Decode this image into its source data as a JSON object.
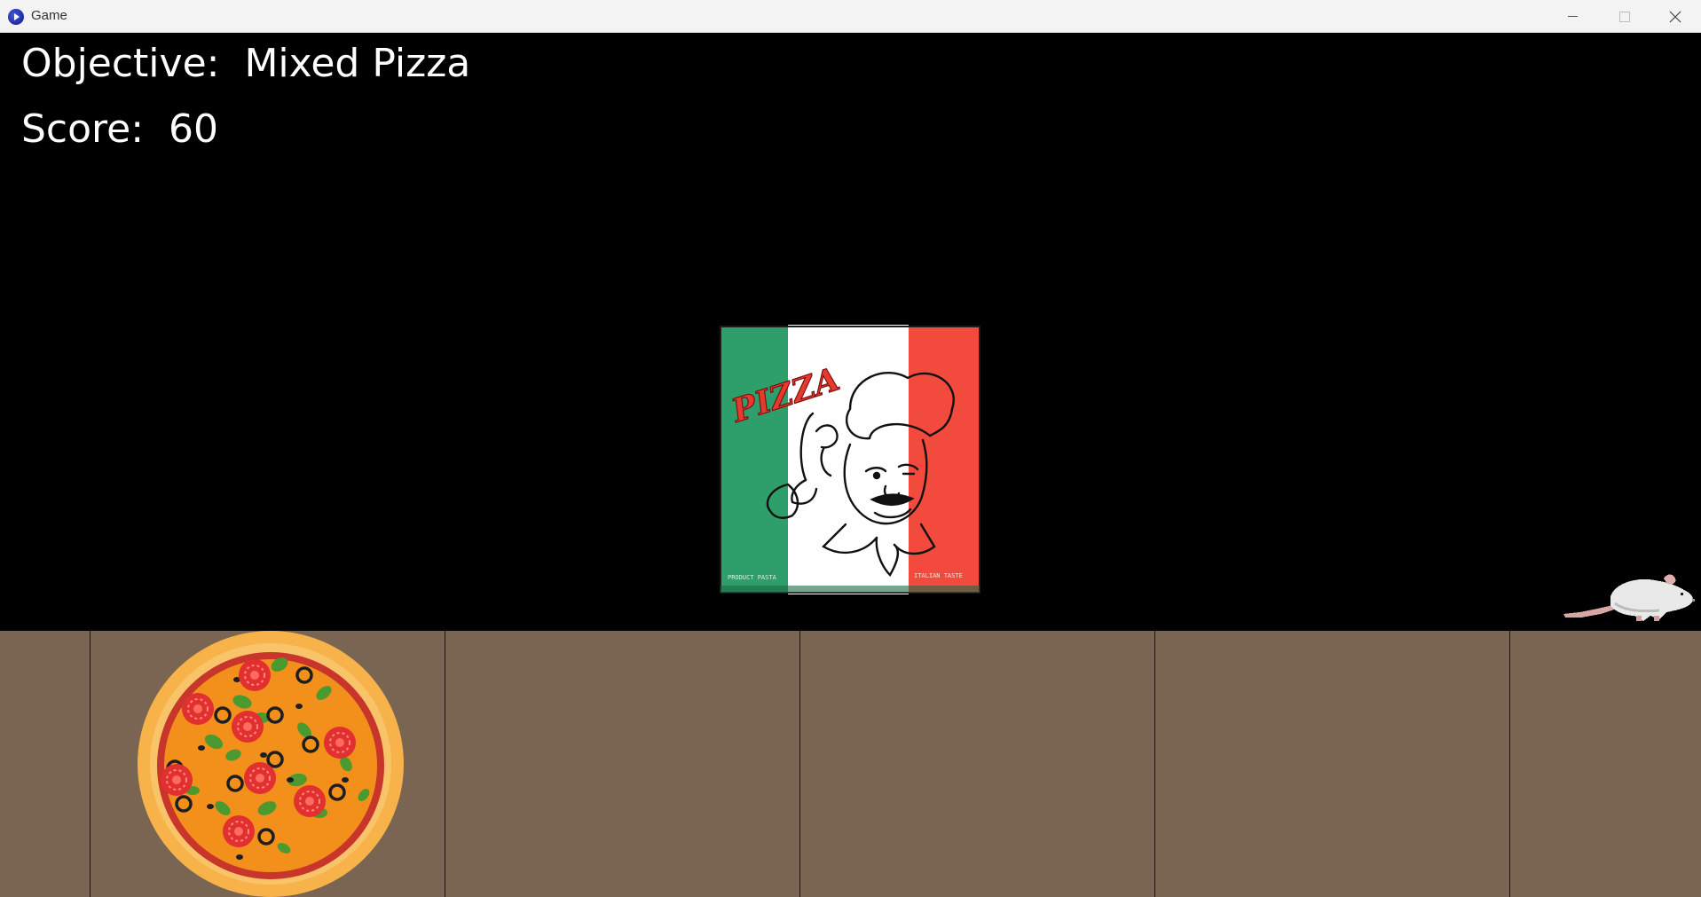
{
  "window": {
    "title": "Game"
  },
  "hud": {
    "objective_label": "Objective:",
    "objective_value": "Mixed Pizza",
    "score_label": "Score:",
    "score_value": "60"
  },
  "pizza_box": {
    "brand_text": "PIZZA",
    "left_small_text": "PRODUCT PASTA",
    "right_small_text": "ITALIAN TASTE",
    "colors": {
      "green": "#2e9e6a",
      "white": "#ffffff",
      "red": "#f24a3c"
    }
  },
  "counter": {
    "color": "#7a6552",
    "slot_count": 6
  },
  "sprites": {
    "pizza": "mixed-pizza-icon",
    "rat": "rat-icon",
    "box": "pizza-box-icon"
  }
}
